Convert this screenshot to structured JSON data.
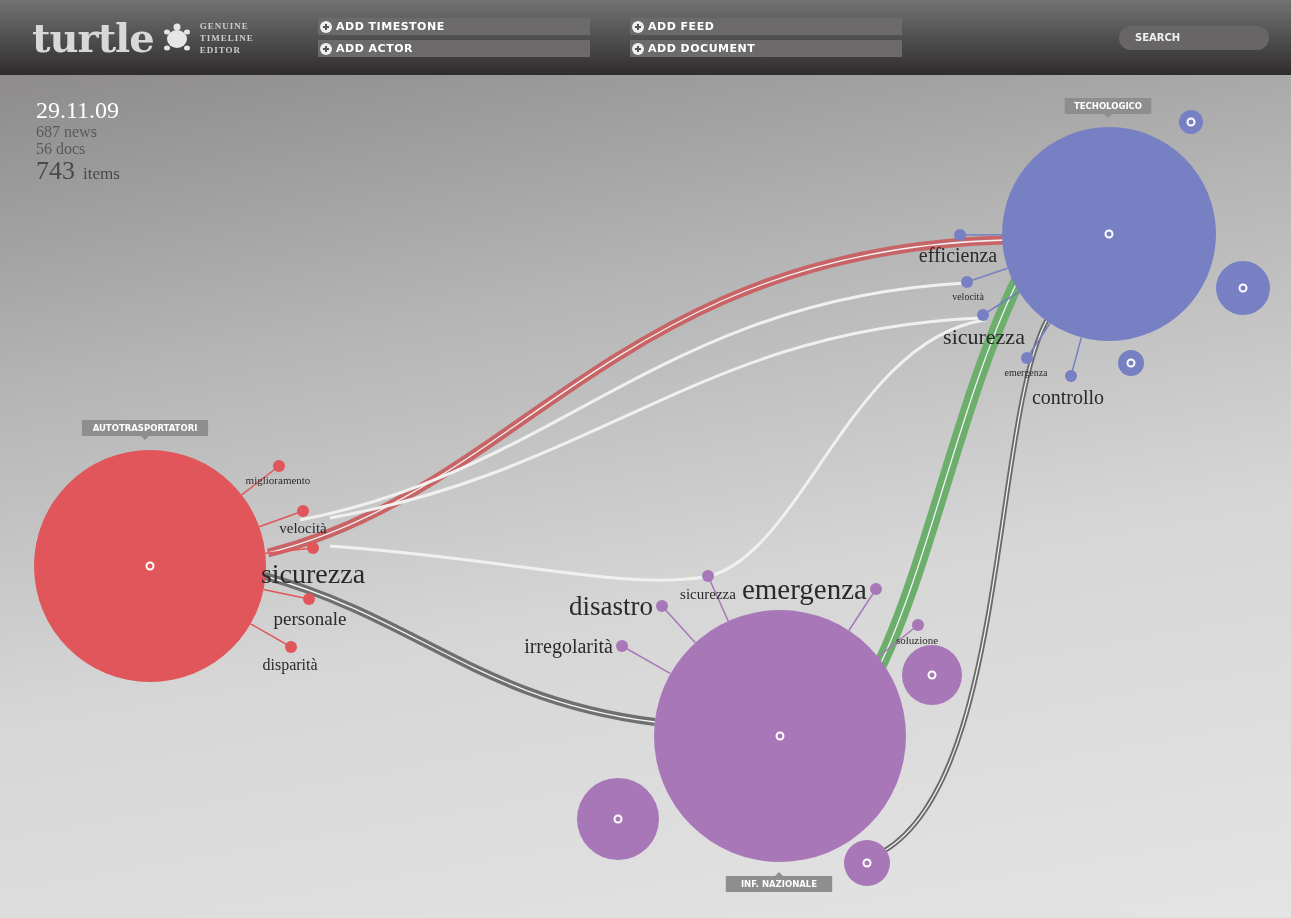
{
  "app": {
    "logo": "turtle",
    "subtitle": [
      "GENUINE",
      "TIMELINE",
      "EDITOR"
    ]
  },
  "actions": [
    {
      "label": "ADD TIMESTONE"
    },
    {
      "label": "ADD ACTOR"
    },
    {
      "label": "ADD FEED"
    },
    {
      "label": "ADD DOCUMENT"
    }
  ],
  "search": {
    "placeholder": "SEARCH"
  },
  "stats": {
    "date": "29.11.09",
    "news": "687 news",
    "docs": "56 docs",
    "items_count": "743",
    "items_label": "items"
  },
  "actors": [
    {
      "label": "AUTOTRASPORTATORI",
      "color": "#e0565a",
      "keywords": [
        "miglioramento",
        "velocità",
        "sicurezza",
        "personale",
        "disparità"
      ]
    },
    {
      "label": "TECHOLOGICO",
      "color": "#7680c3",
      "keywords": [
        "efficienza",
        "velocità",
        "sicurezza",
        "emergenza",
        "controllo"
      ]
    },
    {
      "label": "INF. NAZIONALE",
      "color": "#a877b8",
      "keywords": [
        "sicurezza",
        "disastro",
        "irregolarità",
        "emergenza",
        "soluzione"
      ]
    }
  ],
  "links": [
    {
      "color": "#c96466"
    },
    {
      "color": "#f0f0f0"
    },
    {
      "color": "#f0f0f0"
    },
    {
      "color": "#f0f0f0"
    },
    {
      "color": "#6f6f6f"
    },
    {
      "color": "#6cae6c"
    },
    {
      "color": "#6a6a6a"
    }
  ]
}
